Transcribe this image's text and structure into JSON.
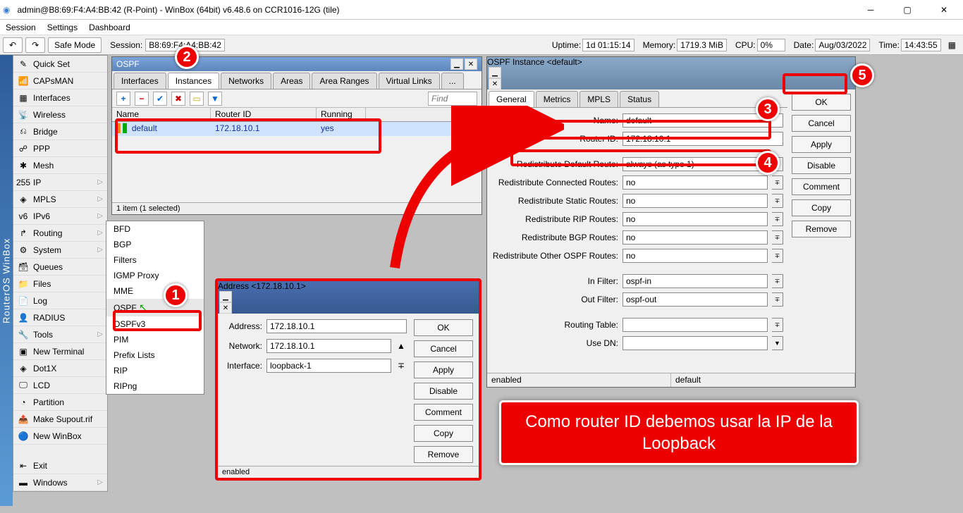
{
  "window": {
    "title": "admin@B8:69:F4:A4:BB:42 (R-Point) - WinBox (64bit) v6.48.6 on CCR1016-12G (tile)"
  },
  "menubar": [
    "Session",
    "Settings",
    "Dashboard"
  ],
  "toolbar": {
    "safeMode": "Safe Mode",
    "sessionLabel": "Session:",
    "sessionValue": "B8:69:F4:A4:BB:42",
    "uptimeLabel": "Uptime:",
    "uptime": "1d 01:15:14",
    "memLabel": "Memory:",
    "mem": "1719.3 MiB",
    "cpuLabel": "CPU:",
    "cpu": "0%",
    "dateLabel": "Date:",
    "date": "Aug/03/2022",
    "timeLabel": "Time:",
    "time": "14:43:55"
  },
  "vbar": "RouterOS WinBox",
  "sidebar": [
    {
      "icon": "✎",
      "label": "Quick Set"
    },
    {
      "icon": "📶",
      "label": "CAPsMAN"
    },
    {
      "icon": "▦",
      "label": "Interfaces"
    },
    {
      "icon": "📡",
      "label": "Wireless"
    },
    {
      "icon": "⎌",
      "label": "Bridge"
    },
    {
      "icon": "☍",
      "label": "PPP"
    },
    {
      "icon": "✱",
      "label": "Mesh"
    },
    {
      "icon": "255",
      "label": "IP",
      "sub": true
    },
    {
      "icon": "◈",
      "label": "MPLS",
      "sub": true
    },
    {
      "icon": "v6",
      "label": "IPv6",
      "sub": true
    },
    {
      "icon": "↱",
      "label": "Routing",
      "sub": true
    },
    {
      "icon": "⚙",
      "label": "System",
      "sub": true
    },
    {
      "icon": "🗃",
      "label": "Queues"
    },
    {
      "icon": "📁",
      "label": "Files"
    },
    {
      "icon": "📄",
      "label": "Log"
    },
    {
      "icon": "👤",
      "label": "RADIUS"
    },
    {
      "icon": "🔧",
      "label": "Tools",
      "sub": true
    },
    {
      "icon": "▣",
      "label": "New Terminal"
    },
    {
      "icon": "◈",
      "label": "Dot1X"
    },
    {
      "icon": "🖵",
      "label": "LCD"
    },
    {
      "icon": "◔",
      "label": "Partition"
    },
    {
      "icon": "📤",
      "label": "Make Supout.rif"
    },
    {
      "icon": "🔵",
      "label": "New WinBox"
    },
    {
      "icon": "⇤",
      "label": "Exit"
    },
    {
      "icon": "▬",
      "label": "Windows",
      "sub": true
    }
  ],
  "submenu": [
    "BFD",
    "BGP",
    "Filters",
    "IGMP Proxy",
    "MME",
    "OSPF",
    "OSPFv3",
    "PIM",
    "Prefix Lists",
    "RIP",
    "RIPng"
  ],
  "ospf": {
    "title": "OSPF",
    "tabs": [
      "Interfaces",
      "Instances",
      "Networks",
      "Areas",
      "Area Ranges",
      "Virtual Links",
      "..."
    ],
    "activeTab": 1,
    "find": "Find",
    "cols": {
      "name": "Name",
      "router": "Router ID",
      "running": "Running"
    },
    "row": {
      "name": "default",
      "router": "172.18.10.1",
      "running": "yes"
    },
    "status": "1 item (1 selected)"
  },
  "addr": {
    "title": "Address <172.18.10.1>",
    "fields": {
      "address": "Address:",
      "network": "Network:",
      "interface": "Interface:"
    },
    "vals": {
      "address": "172.18.10.1",
      "network": "172.18.10.1",
      "interface": "loopback-1"
    },
    "buttons": [
      "OK",
      "Cancel",
      "Apply",
      "Disable",
      "Comment",
      "Copy",
      "Remove"
    ],
    "status": "enabled"
  },
  "inst": {
    "title": "OSPF Instance <default>",
    "tabs": [
      "General",
      "Metrics",
      "MPLS",
      "Status"
    ],
    "labels": {
      "name": "Name:",
      "router": "Router ID:",
      "rdr": "Redistribute Default Route:",
      "rcr": "Redistribute Connected Routes:",
      "rsr": "Redistribute Static Routes:",
      "rrip": "Redistribute RIP Routes:",
      "rbgp": "Redistribute BGP Routes:",
      "rospf": "Redistribute Other OSPF Routes:",
      "inf": "In Filter:",
      "outf": "Out Filter:",
      "rt": "Routing Table:",
      "dn": "Use DN:"
    },
    "vals": {
      "name": "default",
      "router": "172.18.10.1",
      "rdr": "always (as type 1)",
      "rcr": "no",
      "rsr": "no",
      "rrip": "no",
      "rbgp": "no",
      "rospf": "no",
      "inf": "ospf-in",
      "outf": "ospf-out",
      "rt": "",
      "dn": ""
    },
    "buttons": [
      "OK",
      "Cancel",
      "Apply",
      "Disable",
      "Comment",
      "Copy",
      "Remove"
    ],
    "status1": "enabled",
    "status2": "default"
  },
  "callout": "Como router ID debemos usar la IP de la Loopback",
  "badges": [
    "1",
    "2",
    "3",
    "4",
    "5"
  ]
}
